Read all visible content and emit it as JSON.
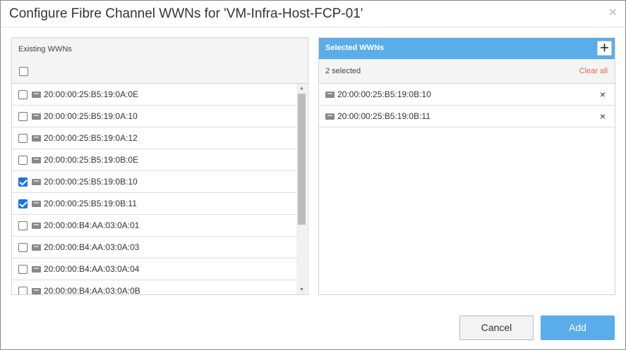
{
  "dialog": {
    "title": "Configure Fibre Channel WWNs for 'VM-Infra-Host-FCP-01'",
    "close": "×"
  },
  "existing": {
    "label": "Existing WWNs",
    "items": [
      {
        "wwn": "20:00:00:25:B5:19:0A:0E",
        "checked": false
      },
      {
        "wwn": "20:00:00:25:B5:19:0A:10",
        "checked": false
      },
      {
        "wwn": "20:00:00:25:B5:19:0A:12",
        "checked": false
      },
      {
        "wwn": "20:00:00:25:B5:19:0B:0E",
        "checked": false
      },
      {
        "wwn": "20:00:00:25:B5:19:0B:10",
        "checked": true
      },
      {
        "wwn": "20:00:00:25:B5:19:0B:11",
        "checked": true
      },
      {
        "wwn": "20:00:00:B4:AA:03:0A:01",
        "checked": false
      },
      {
        "wwn": "20:00:00:B4:AA:03:0A:03",
        "checked": false
      },
      {
        "wwn": "20:00:00:B4:AA:03:0A:04",
        "checked": false
      },
      {
        "wwn": "20:00:00:B4:AA:03:0A:0B",
        "checked": false
      }
    ]
  },
  "selected": {
    "label": "Selected WWNs",
    "add_icon": "+",
    "count": "2 selected",
    "clear": "Clear all",
    "remove_icon": "×",
    "items": [
      "20:00:00:25:B5:19:0B:10",
      "20:00:00:25:B5:19:0B:11"
    ]
  },
  "buttons": {
    "cancel": "Cancel",
    "add": "Add"
  }
}
